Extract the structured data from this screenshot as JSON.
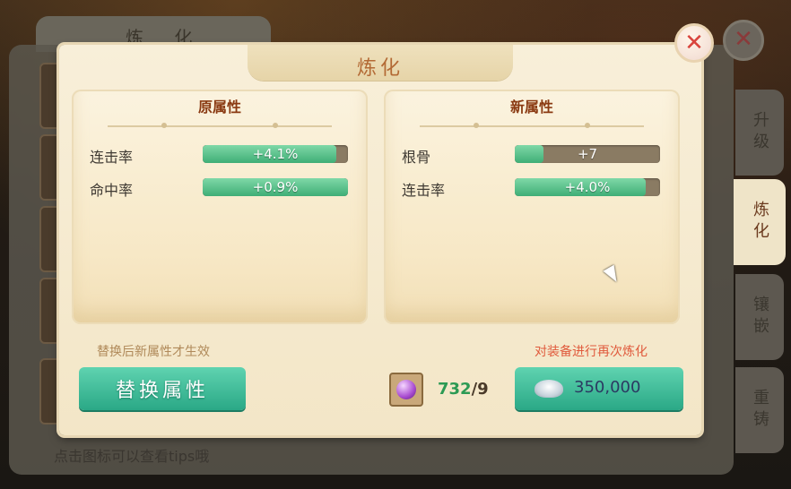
{
  "background": {
    "panel_title": "炼 化",
    "hint": "点击图标可以查看tips哦",
    "close_icon": "close-icon"
  },
  "side_tabs": [
    {
      "label": "升级",
      "active": false
    },
    {
      "label": "炼化",
      "active": true
    },
    {
      "label": "镶嵌",
      "active": false
    },
    {
      "label": "重铸",
      "active": false
    }
  ],
  "dialog": {
    "title": "炼化",
    "close_icon": "close-icon"
  },
  "original": {
    "heading": "原属性",
    "attrs": [
      {
        "name": "连击率",
        "value": "+4.1%",
        "fill": 0.92
      },
      {
        "name": "命中率",
        "value": "+0.9%",
        "fill": 1.0
      }
    ]
  },
  "new": {
    "heading": "新属性",
    "attrs": [
      {
        "name": "根骨",
        "value": "+7",
        "fill": 0.2
      },
      {
        "name": "连击率",
        "value": "+4.0%",
        "fill": 0.9
      }
    ]
  },
  "hints": {
    "left": "替换后新属性才生效",
    "right": "对装备进行再次炼化"
  },
  "buttons": {
    "replace_label": "替换属性",
    "smelt_cost": "350,000"
  },
  "material": {
    "icon": "purple-orb-icon",
    "have": "732",
    "need": "/9"
  },
  "colors": {
    "accent_green": "#3fae76",
    "title_color": "#b36a35",
    "warning": "#e05a3c"
  }
}
